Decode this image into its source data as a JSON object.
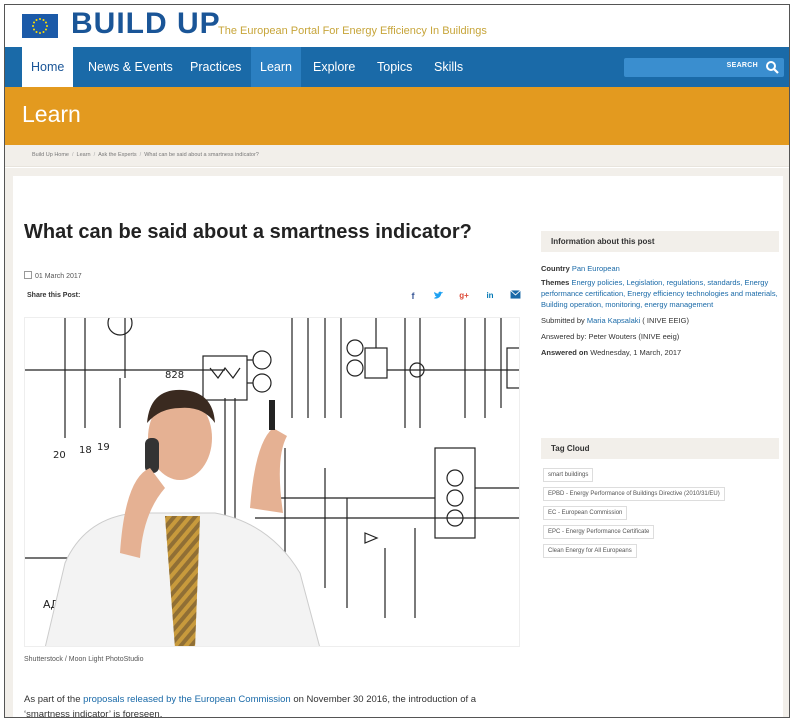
{
  "header": {
    "brand_name": "BUILD UP",
    "tagline": "The European Portal For Energy Efficiency In Buildings"
  },
  "nav": {
    "items": [
      "Home",
      "News & Events",
      "Practices",
      "Learn",
      "Explore",
      "Topics",
      "Skills"
    ],
    "search_label": "SEARCH"
  },
  "banner": {
    "title": "Learn"
  },
  "breadcrumb": [
    "Build Up Home",
    "Learn",
    "Ask the Experts",
    "What can be said about a smartness indicator?"
  ],
  "article": {
    "title": "What can be said about a smartness indicator?",
    "date": "01 March 2017",
    "share_label": "Share this Post:",
    "photo_credit": "Shutterstock / Moon Light PhotoStudio",
    "body_prefix": "As part of the ",
    "body_link": "proposals released by the European Commission",
    "body_suffix": " on November 30 2016, the introduction of a ‘smartness indicator’ is foreseen."
  },
  "sidebar": {
    "info_heading": "Information about this post",
    "country_label": "Country",
    "country_value": "Pan European",
    "themes_label": "Themes",
    "themes_value": "Energy policies, Legislation, regulations, standards, Energy performance certification, Energy efficiency technologies and materials, Building operation, monitoring, energy management",
    "submitted_prefix": "Submitted by ",
    "submitted_name": "Maria Kapsalaki",
    "submitted_suffix": " ( INIVE EEIG)",
    "answered_by": "Answered by: Peter Wouters (INIVE eeig)",
    "answered_on_label": "Answered on",
    "answered_on_value": "Wednesday, 1 March, 2017",
    "tag_heading": "Tag Cloud",
    "tags": [
      "smart buildings",
      "EPBD - Energy Performance of Buildings Directive (2010/31/EU)",
      "EC - European Commission",
      "EPC - Energy Performance Certificate",
      "Clean Energy for All Europeans"
    ]
  },
  "colors": {
    "nav_blue": "#1a6aa8",
    "brand_blue": "#1a5597",
    "banner_orange": "#e39a1f",
    "tagline_gold": "#c7a53a"
  }
}
